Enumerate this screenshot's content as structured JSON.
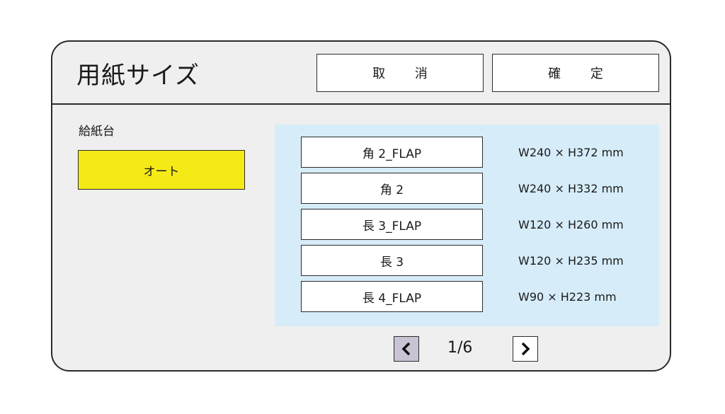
{
  "header": {
    "title": "用紙サイズ",
    "cancel_label": "取 消",
    "confirm_label": "確 定"
  },
  "tray": {
    "label": "給紙台",
    "selected": "オート",
    "selected_color": "#f5ea16"
  },
  "sizes": [
    {
      "name": "角 2_FLAP",
      "dimensions": "W240 × H372 mm"
    },
    {
      "name": "角 2",
      "dimensions": "W240 × H332 mm"
    },
    {
      "name": "長 3_FLAP",
      "dimensions": "W120 × H260 mm"
    },
    {
      "name": "長 3",
      "dimensions": "W120 × H235 mm"
    },
    {
      "name": "長 4_FLAP",
      "dimensions": "W90 × H223 mm"
    }
  ],
  "list_background": "#d6ecf9",
  "pager": {
    "text": "1/6",
    "prev_icon": "chevron-left-icon",
    "next_icon": "chevron-right-icon"
  }
}
